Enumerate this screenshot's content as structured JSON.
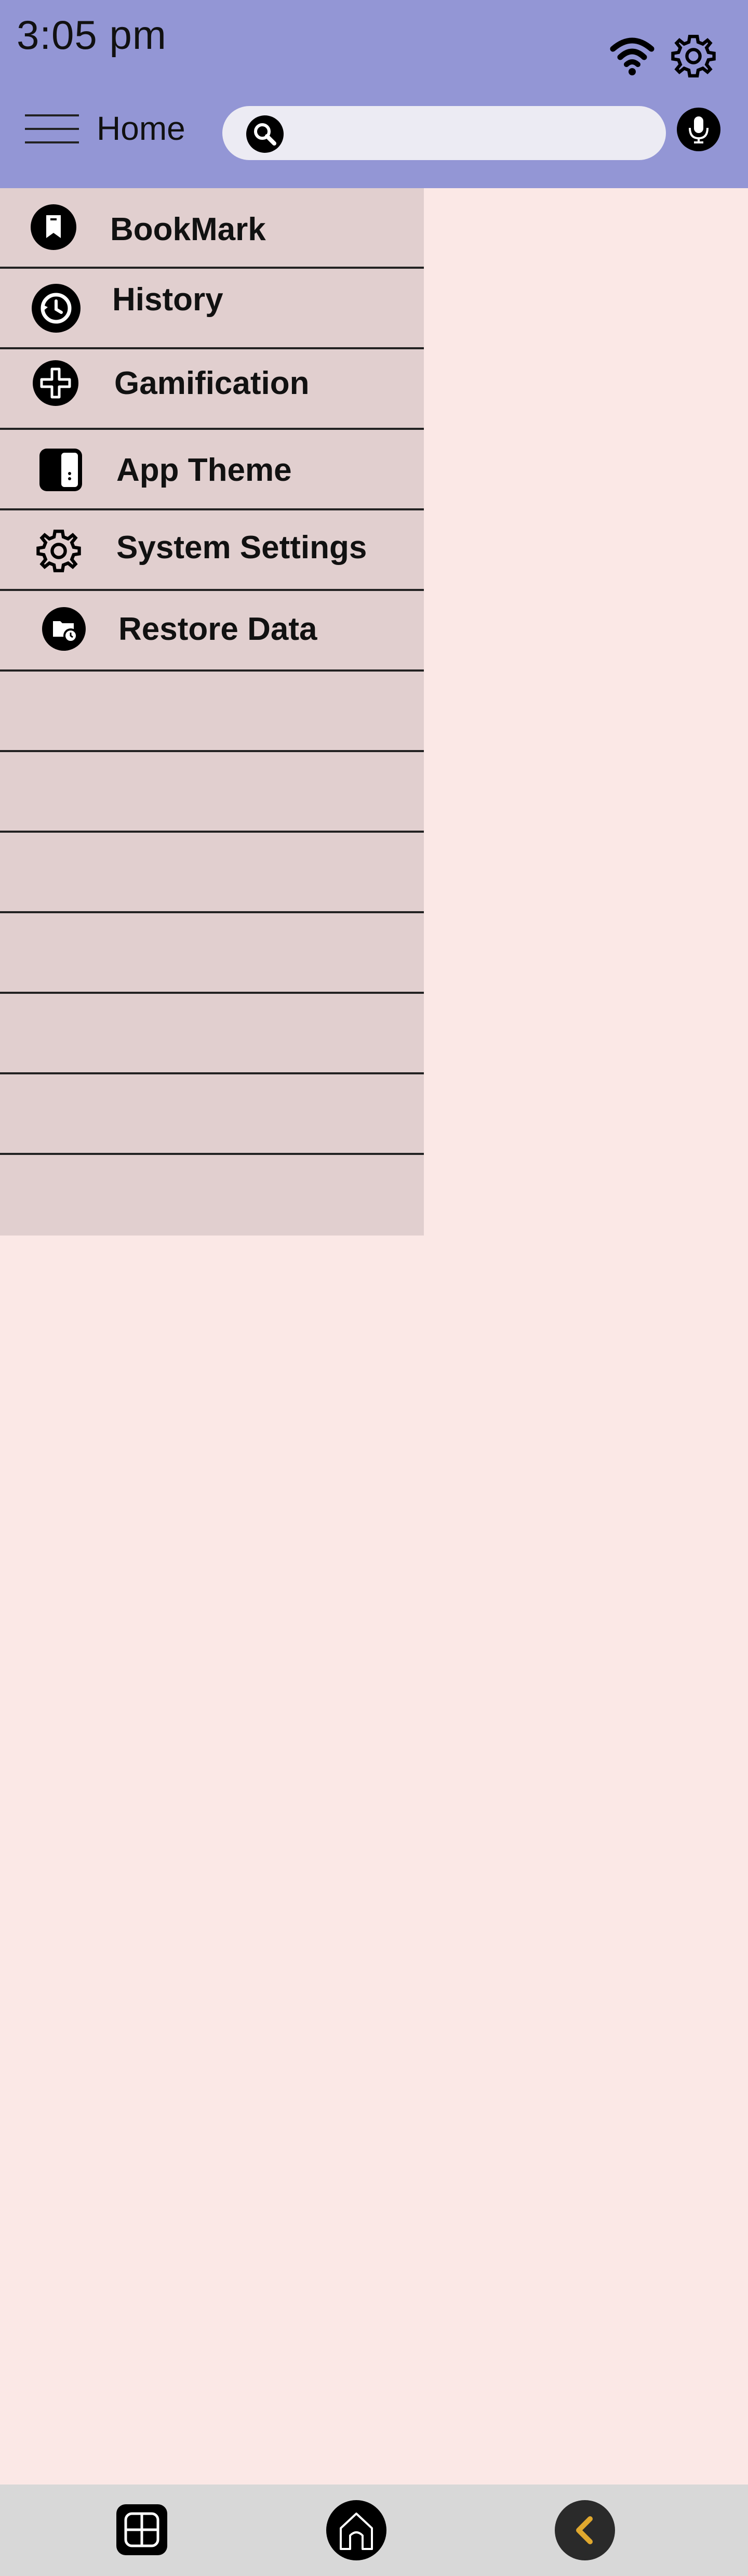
{
  "status": {
    "time": "3:05 pm",
    "icons": [
      "wifi-icon",
      "gear-icon"
    ]
  },
  "header": {
    "menu_icon": "hamburger-icon",
    "title": "Home",
    "search": {
      "placeholder": "",
      "value": "",
      "icon": "search-icon"
    },
    "mic_icon": "mic-icon"
  },
  "menu": {
    "items": [
      {
        "label": "BookMark",
        "icon": "bookmark-icon"
      },
      {
        "label": "History",
        "icon": "history-icon"
      },
      {
        "label": "Gamification",
        "icon": "gamepad-icon"
      },
      {
        "label": "App Theme",
        "icon": "theme-icon"
      },
      {
        "label": "System Settings",
        "icon": "settings-icon"
      },
      {
        "label": "Restore Data",
        "icon": "restore-icon"
      },
      {
        "label": ""
      },
      {
        "label": ""
      },
      {
        "label": ""
      },
      {
        "label": ""
      },
      {
        "label": ""
      },
      {
        "label": ""
      },
      {
        "label": ""
      }
    ]
  },
  "bottom_nav": {
    "items": [
      {
        "icon": "grid-icon"
      },
      {
        "icon": "home-icon"
      },
      {
        "icon": "back-icon"
      }
    ]
  },
  "colors": {
    "header": "#9396d5",
    "background": "#fbe8e6",
    "menu": "#e1cfcf",
    "bottom_bar": "#d8d8d8",
    "back_arrow": "#e0a82e"
  }
}
